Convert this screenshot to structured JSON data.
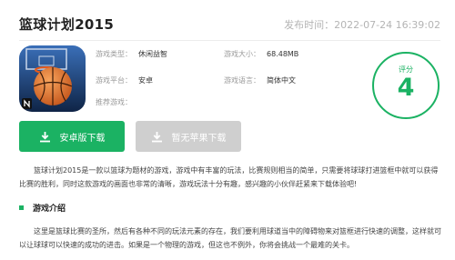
{
  "page": {
    "title": "篮球计划2015",
    "publish_time": "发布时间：2022-07-24 16:39:02"
  },
  "info": {
    "type_label": "游戏类型：",
    "type_value": "休闲益智",
    "size_label": "游戏大小：",
    "size_value": "68.48MB",
    "platform_label": "游戏平台：",
    "platform_value": "安卓",
    "lang_label": "游戏语言：",
    "lang_value": "简体中文",
    "recommend_label": "推荐游戏："
  },
  "score": {
    "label": "评分",
    "value": "4"
  },
  "buttons": {
    "android": "安卓版下载",
    "apple": "暂无苹果下载"
  },
  "content": {
    "intro": "篮球计划2015是一款以篮球为题材的游戏，游戏中有丰富的玩法，比赛规则相当的简单，只需要将球球打进篮框中就可以获得比赛的胜利，同时这款游戏的画面也非常的清晰，游戏玩法十分有趣，感兴趣的小伙伴赶紧来下载体验吧!",
    "section_title": "游戏介绍",
    "section_text": "这里是篮球比赛的圣所，然后有各种不同的玩法元素的存在，我们要利用球道当中的障碍物来对篮框进行快速的调整，这样就可以让球球可以快速的成功的进击。如果是一个物理的游戏，但这也不例外，你将会挑战一个最难的关卡。"
  },
  "colors": {
    "accent": "#1bb263",
    "disabled": "#cfcfcf"
  },
  "icons": {
    "app_icon": "basketball-app-icon",
    "download": "download-icon"
  }
}
